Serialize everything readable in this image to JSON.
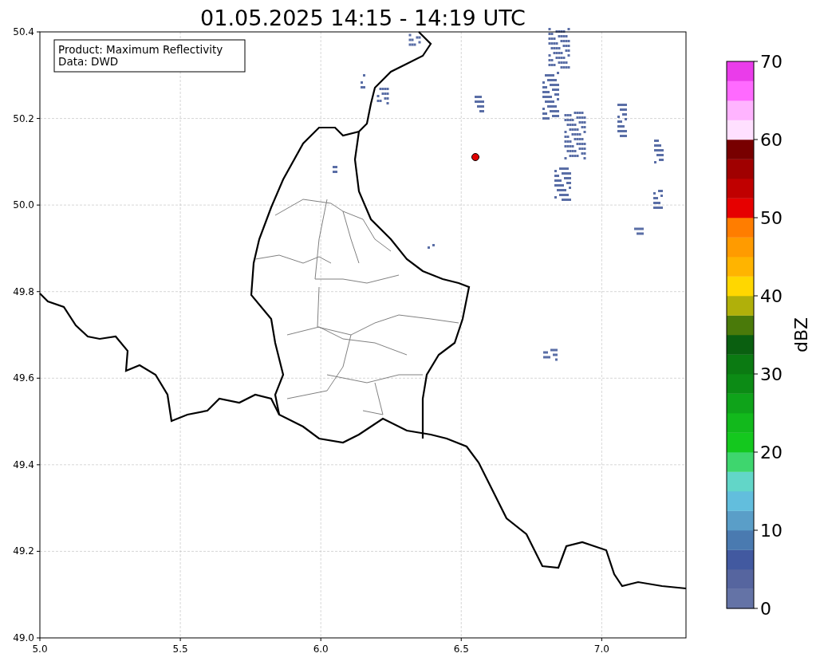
{
  "title": "01.05.2025 14:15 - 14:19 UTC",
  "info_box": {
    "lines": [
      "Product: Maximum Reflectivity",
      "Data: DWD"
    ]
  },
  "x_ticks": [
    "5.0",
    "5.5",
    "6.0",
    "6.5",
    "7.0"
  ],
  "y_ticks": [
    "50.4",
    "50.2",
    "50.0",
    "49.8",
    "49.6",
    "49.4",
    "49.2",
    "49.0"
  ],
  "colorbar": {
    "label": "dBZ",
    "ticks": [
      "70",
      "60",
      "50",
      "40",
      "30",
      "20",
      "10",
      "0"
    ],
    "levels": [
      {
        "color": "#6473a6"
      },
      {
        "color": "#56659f"
      },
      {
        "color": "#4259a0"
      },
      {
        "color": "#4a7ab0"
      },
      {
        "color": "#5a9ec8"
      },
      {
        "color": "#62bedd"
      },
      {
        "color": "#62d6c8"
      },
      {
        "color": "#3ed66e"
      },
      {
        "color": "#14c81e"
      },
      {
        "color": "#12b91c"
      },
      {
        "color": "#0fa31a"
      },
      {
        "color": "#0c8b15"
      },
      {
        "color": "#0b7a12"
      },
      {
        "color": "#0a5f10"
      },
      {
        "color": "#4a7a0a"
      },
      {
        "color": "#b0b00a"
      },
      {
        "color": "#ffd700"
      },
      {
        "color": "#ffb400"
      },
      {
        "color": "#ff9b00"
      },
      {
        "color": "#ff7d00"
      },
      {
        "color": "#e60000"
      },
      {
        "color": "#c00000"
      },
      {
        "color": "#a00000"
      },
      {
        "color": "#780000"
      },
      {
        "color": "#ffe0ff"
      },
      {
        "color": "#ffb4ff"
      },
      {
        "color": "#ff6aff"
      },
      {
        "color": "#ea3cea"
      }
    ]
  }
}
